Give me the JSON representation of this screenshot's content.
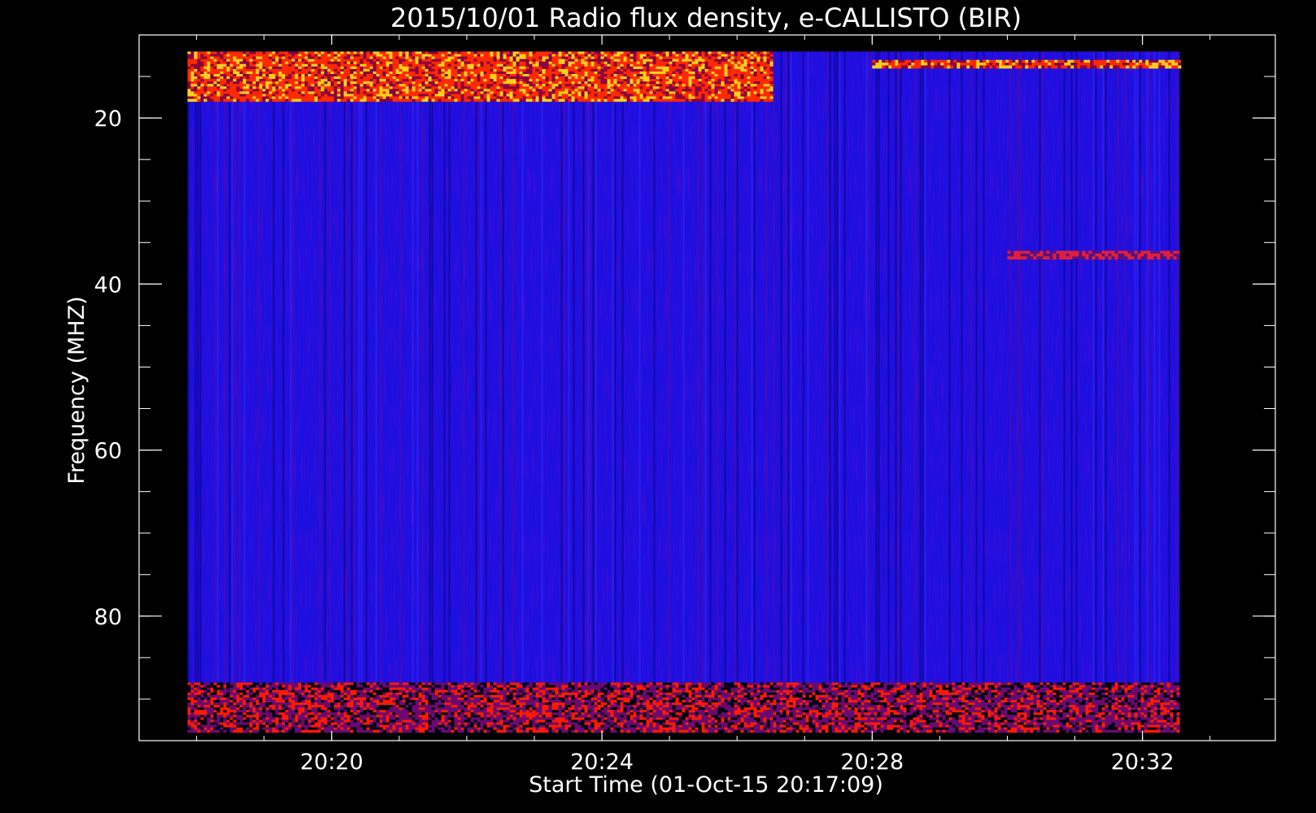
{
  "chart_data": {
    "type": "heatmap",
    "title": "2015/10/01  Radio flux density, e-CALLISTO (BIR)",
    "xlabel": "Start Time (01-Oct-15 20:17:09)",
    "ylabel": "Frequency (MHZ)",
    "x_axis": {
      "range": [
        "20:17:09",
        "20:33:58"
      ],
      "data_span": [
        "20:17:52",
        "20:32:33"
      ],
      "major_ticks": [
        "20:20",
        "20:24",
        "20:28",
        "20:32"
      ],
      "minor_tick_interval_min": 1
    },
    "y_axis": {
      "range": [
        10,
        95
      ],
      "inverted": true,
      "data_span": [
        12,
        94
      ],
      "major_ticks": [
        20,
        40,
        60,
        80
      ],
      "minor_tick_interval": 5
    },
    "colormap": [
      "#000000",
      "#0000ff",
      "#ff0000",
      "#ffff00",
      "#ffffff"
    ],
    "features": [
      {
        "label": "narrowband RFI",
        "freq_mhz": [
          12,
          18
        ],
        "time": [
          "20:17:52",
          "20:26:30"
        ],
        "intensity": "high"
      },
      {
        "label": "narrowband RFI",
        "freq_mhz": [
          13,
          14
        ],
        "time": [
          "20:28:00",
          "20:32:33"
        ],
        "intensity": "high"
      },
      {
        "label": "narrowband RFI",
        "freq_mhz": [
          36,
          37
        ],
        "time": [
          "20:30:00",
          "20:32:33"
        ],
        "intensity": "medium"
      },
      {
        "label": "low-frequency band",
        "freq_mhz": [
          88,
          94
        ],
        "time": [
          "20:17:52",
          "20:32:33"
        ],
        "intensity": "mixed"
      }
    ],
    "grid": false,
    "legend": "none"
  }
}
